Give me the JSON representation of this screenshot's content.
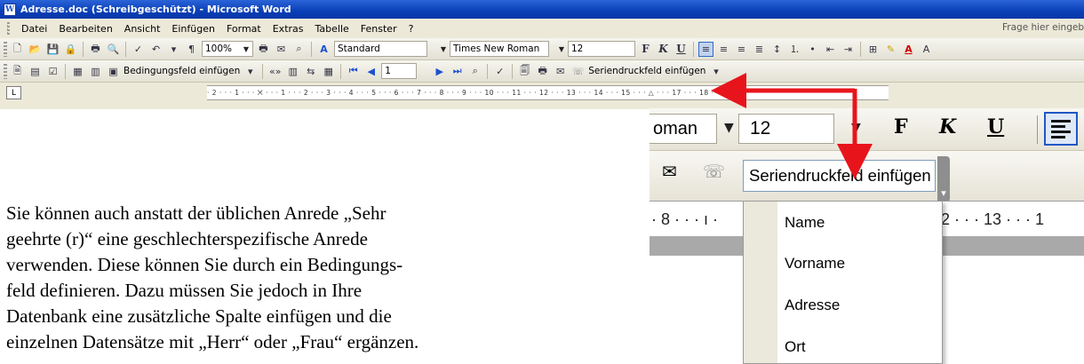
{
  "window": {
    "title": "Adresse.doc (Schreibgeschützt) - Microsoft Word",
    "icon": "word-doc-icon"
  },
  "menubar": {
    "items": [
      {
        "label": "Datei"
      },
      {
        "label": "Bearbeiten"
      },
      {
        "label": "Ansicht"
      },
      {
        "label": "Einfügen"
      },
      {
        "label": "Format"
      },
      {
        "label": "Extras"
      },
      {
        "label": "Tabelle"
      },
      {
        "label": "Fenster"
      },
      {
        "label": "?"
      }
    ],
    "help_placeholder": "Frage hier eingeb"
  },
  "standard_toolbar": {
    "zoom": "100%",
    "style": "Standard",
    "font": "Times New Roman",
    "size": "12"
  },
  "mailmerge_toolbar": {
    "condition_field_label": "Bedingungsfeld einfügen",
    "record_number": "1",
    "merge_field_label": "Seriendruckfeld einfügen"
  },
  "ruler": {
    "ticks": "· 2 · · · 1 · · · ⨉ · · · 1 · · · 2 · · · 3 · · · 4 · · · 5 · · · 6 · · · 7 · · · 8 · · · 9 · · · 10 · · · 11 · · · 12 · · · 13 · · · 14 · · · 15 · · · △ · · · 17 · · · 18 ·"
  },
  "zoom_inset": {
    "font_fragment": "oman",
    "size": "12",
    "merge_field_label": "Seriendruckfeld einfügen",
    "ruler_left": "· 8 · · · ı ·",
    "ruler_right": "12 · · · 13 · · · 1",
    "dropdown_items": [
      "Name",
      "Vorname",
      "Adresse",
      "Ort"
    ]
  },
  "body": {
    "lines": [
      "Sie können auch anstatt der üblichen Anrede „Sehr",
      "geehrte (r)“ eine geschlechterspezifische Anrede",
      "verwenden. Diese können Sie durch ein Bedingungs-",
      "feld definieren. Dazu müssen Sie jedoch in Ihre",
      "Datenbank eine zusätzliche Spalte einfügen und die",
      "einzelnen Datensätze mit „Herr“ oder „Frau“ ergänzen."
    ]
  },
  "colors": {
    "accent_arrow": "#e8141b",
    "titlebar": "#0a3fb6",
    "toolbar_bg": "#ece9d8"
  }
}
